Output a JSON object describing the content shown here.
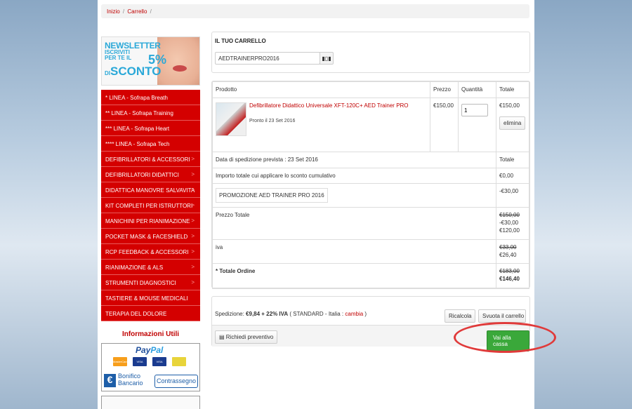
{
  "breadcrumb": {
    "home": "Inizio",
    "cart": "Carrello",
    "sep": "/"
  },
  "newsletter": {
    "title": "NEWSLETTER",
    "sub1": "ISCRIVITI",
    "sub2": "PER TE IL",
    "percent": "5%",
    "sub3": "DI",
    "sconto": "SCONTO"
  },
  "menu": [
    {
      "label": "* LINEA - Sofrapa Breath",
      "arrow": false
    },
    {
      "label": "** LINEA - Sofrapa Training",
      "arrow": false
    },
    {
      "label": "*** LINEA - Sofrapa Heart",
      "arrow": false
    },
    {
      "label": "**** LINEA - Sofrapa Tech",
      "arrow": false
    },
    {
      "label": "DEFIBRILLATORI & ACCESSORI",
      "arrow": true
    },
    {
      "label": "DEFIBRILLATORI DIDATTICI",
      "arrow": true
    },
    {
      "label": "DIDATTICA MANOVRE SALVAVITA",
      "arrow": true
    },
    {
      "label": "KIT COMPLETI PER ISTRUTTORI",
      "arrow": true
    },
    {
      "label": "MANICHINI PER RIANIMAZIONE",
      "arrow": true
    },
    {
      "label": "POCKET MASK & FACESHIELD",
      "arrow": true
    },
    {
      "label": "RCP FEEDBACK & ACCESSORI",
      "arrow": true
    },
    {
      "label": "RIANIMAZIONE & ALS",
      "arrow": true
    },
    {
      "label": "STRUMENTI DIAGNOSTICI",
      "arrow": true
    },
    {
      "label": "TASTIERE & MOUSE MEDICALI",
      "arrow": false
    },
    {
      "label": "TERAPIA DEL DOLORE",
      "arrow": false
    }
  ],
  "info": {
    "title": "Informazioni Utili",
    "paypal_1": "Pay",
    "paypal_2": "Pal",
    "cards": [
      {
        "label": "MasterCard",
        "color": "#f79e1b"
      },
      {
        "label": "VISA",
        "color": "#1a3b8f"
      },
      {
        "label": "VISA",
        "color": "#1a3b8f"
      },
      {
        "label": "",
        "color": "#e8d43a"
      }
    ],
    "bonifico_1": "Bonifico",
    "bonifico_2": "Bancario",
    "contrassegno": "Contrassegno"
  },
  "cart": {
    "title": "IL TUO CARRELLO",
    "coupon_value": "AEDTRAINERPRO2016",
    "headers": {
      "product": "Prodotto",
      "price": "Prezzo",
      "qty": "Quantità",
      "total": "Totale"
    },
    "item": {
      "name": "Defibrillatore Didattico Universale XFT-120C+ AED Trainer PRO",
      "ready": "Pronto il 23 Set 2016",
      "price": "€150,00",
      "qty": "1",
      "total": "€150,00",
      "remove": "elimina"
    },
    "shipping_date": "Data di spedizione prevista : 23 Set 2016",
    "shipping_total_label": "Totale",
    "discount_label": "Importo totale cui applicare lo sconto cumulativo",
    "discount_value": "€0,00",
    "promo_label": "PROMOZIONE AED TRAINER PRO 2016",
    "promo_value": "-€30,00",
    "subtotal_label": "Prezzo Totale",
    "subtotal_old": "€150,00",
    "subtotal_disc": "-€30,00",
    "subtotal_new": "€120,00",
    "iva_label": "iva",
    "iva_old": "€33,00",
    "iva_new": "€26,40",
    "order_total_label": "* Totale Ordine",
    "order_total_old": "€183,00",
    "order_total_new": "€146,40"
  },
  "shipping": {
    "prefix": "Spedizione:",
    "amount": "€9,84 + 22% IVA",
    "detail": "( STANDARD - Italia :",
    "change": "cambia",
    "close": ")",
    "recalc": "Ricalcola",
    "empty": "Svuota il carrello",
    "quote": "Richiedi preventivo",
    "checkout": "Vai alla cassa"
  }
}
